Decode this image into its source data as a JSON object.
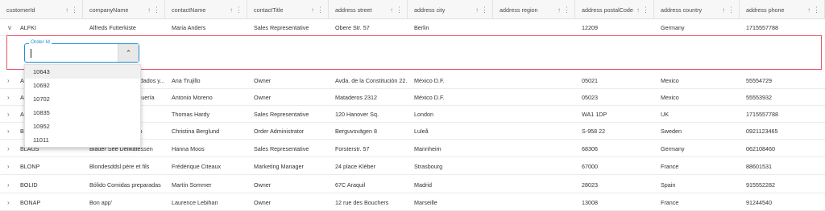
{
  "columns": [
    {
      "label": "customerId"
    },
    {
      "label": "companyName"
    },
    {
      "label": "contactName"
    },
    {
      "label": "contactTitle"
    },
    {
      "label": "address street"
    },
    {
      "label": "address city"
    },
    {
      "label": "address region"
    },
    {
      "label": "address postalCode"
    },
    {
      "label": "address country"
    },
    {
      "label": "address phone"
    }
  ],
  "header_icons": {
    "sort": "↑",
    "menu": "⋮"
  },
  "expand_icon_open": "∨",
  "expand_icon_closed": "›",
  "first_row": [
    "ALFKI",
    "Alfreds Futterkiste",
    "Maria Anders",
    "Sales Representative",
    "Obere Str. 57",
    "Berlin",
    "",
    "12209",
    "Germany",
    "1715557788"
  ],
  "rows": [
    [
      "A",
      "Ana Trujillo Emparedados y...",
      "Ana Trujillo",
      "Owner",
      "Avda. de la Constitución 22...",
      "México D.F.",
      "",
      "05021",
      "Mexico",
      "55554729"
    ],
    [
      "A",
      "Antonio Moreno Taquería",
      "Antonio Moreno",
      "Owner",
      "Mataderos 2312",
      "México D.F.",
      "",
      "05023",
      "Mexico",
      "55553932"
    ],
    [
      "A",
      "Around the Horn",
      "Thomas Hardy",
      "Sales Representative",
      "120 Hanover Sq.",
      "London",
      "",
      "WA1 1DP",
      "UK",
      "1715557788"
    ],
    [
      "B",
      "Berglunds snabbköp",
      "Christina Berglund",
      "Order Administrator",
      "Berguvsvägen 8",
      "Luleå",
      "",
      "S-958 22",
      "Sweden",
      "0921123465"
    ],
    [
      "BLAUS",
      "Blauer See Delikatessen",
      "Hanna Moos",
      "Sales Representative",
      "Forsterstr. 57",
      "Mannheim",
      "",
      "68306",
      "Germany",
      "062108460"
    ],
    [
      "BLONP",
      "Blondesddsl père et fils",
      "Frédérique Citeaux",
      "Marketing Manager",
      "24 place Kléber",
      "Strasbourg",
      "",
      "67000",
      "France",
      "88601531"
    ],
    [
      "BOLID",
      "Bólido Comidas preparadas",
      "Martín Sommer",
      "Owner",
      "67C Araquil",
      "Madrid",
      "",
      "28023",
      "Spain",
      "915552282"
    ],
    [
      "BONAP",
      "Bon app'",
      "Laurence Lebihan",
      "Owner",
      "12 rue des Bouchers",
      "Marseille",
      "",
      "13008",
      "France",
      "91244540"
    ]
  ],
  "order_combo": {
    "label": "Order Id",
    "value": "",
    "toggle_icon": "⌃",
    "options": [
      "10643",
      "10692",
      "10702",
      "10835",
      "10952",
      "11011"
    ],
    "highlighted": "10643"
  }
}
